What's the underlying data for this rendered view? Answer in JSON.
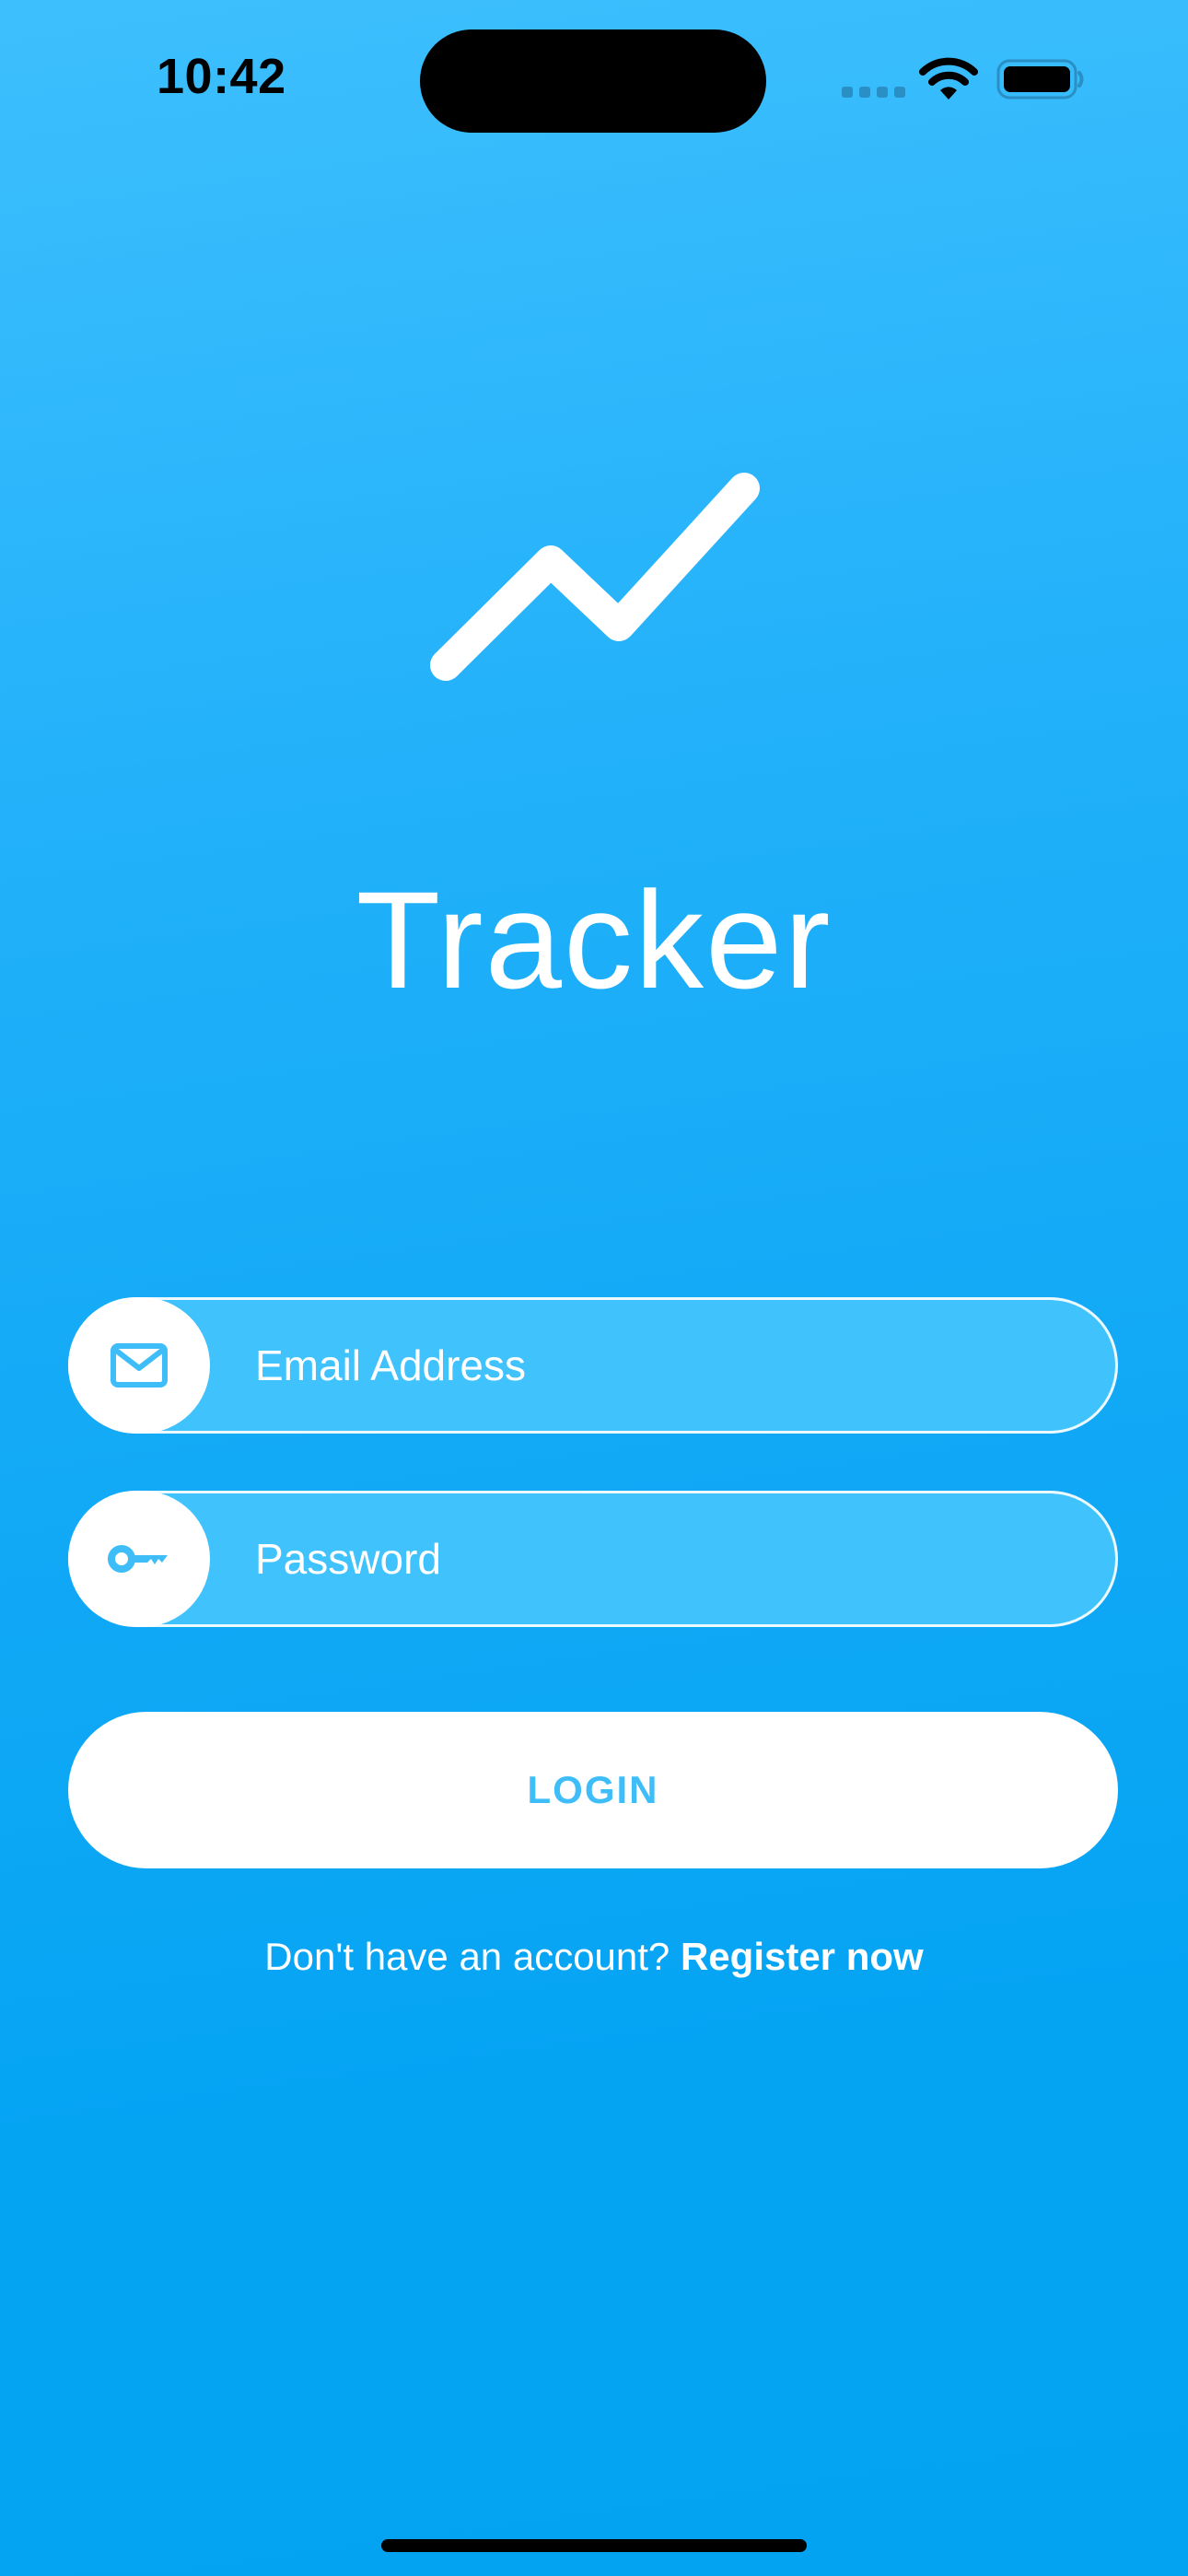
{
  "status_bar": {
    "time": "10:42"
  },
  "app": {
    "title": "Tracker",
    "logo_icon": "trend-line-icon"
  },
  "form": {
    "email": {
      "placeholder": "Email Address",
      "value": "",
      "icon": "envelope-icon"
    },
    "password": {
      "placeholder": "Password",
      "value": "",
      "icon": "key-icon"
    },
    "login_label": "LOGIN"
  },
  "register": {
    "prompt": "Don't have an account?",
    "link_label": "Register now"
  },
  "colors": {
    "background_top": "#3ebffd",
    "background_bottom": "#04a3f2",
    "accent": "#3ebdf8",
    "white": "#ffffff"
  }
}
